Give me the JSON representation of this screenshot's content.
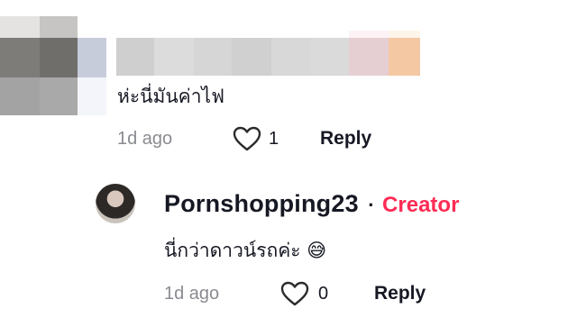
{
  "comment": {
    "text": "ห่ะนี่มันค่าไฟ",
    "time": "1d ago",
    "likes": "1",
    "reply_label": "Reply"
  },
  "reply_comment": {
    "username": "Pornshopping23",
    "separator": "·",
    "badge": "Creator",
    "text": "นี่กว่าดาวน์รถค่ะ",
    "emoji": "😅",
    "time": "1d ago",
    "likes": "0",
    "reply_label": "Reply"
  },
  "colors": {
    "creator_badge": "#fe2c55",
    "meta_text": "#8a8b91"
  },
  "icons": [
    "heart-outline-icon",
    "heart-outline-icon"
  ]
}
